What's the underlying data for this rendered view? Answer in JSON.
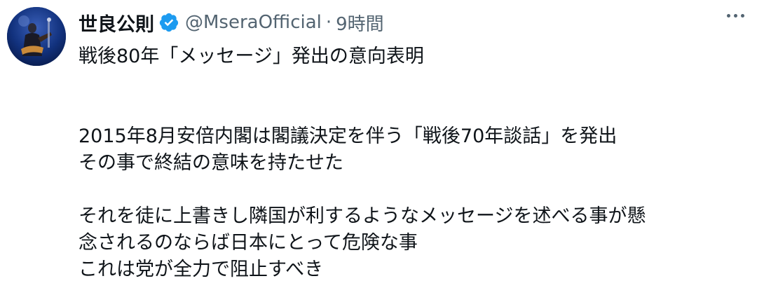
{
  "author": {
    "display_name": "世良公則",
    "handle": "@MseraOfficial",
    "separator": "·",
    "time": "9時間",
    "verified_icon": "verified-badge-icon",
    "avatar_icon": "profile-avatar"
  },
  "menu_icon": "more-options-icon",
  "tweet": {
    "line1": "戦後80年「メッセージ」発出の意向表明",
    "line2": "2015年8月安倍内閣は閣議決定を伴う「戦後70年談話」を発出",
    "line3": "その事で終結の意味を持たせた",
    "line4": "それを徒に上書きし隣国が利するようなメッセージを述べる事が懸",
    "line5": "念されるのならば日本にとって危険な事",
    "line6": "これは党が全力で阻止すべき"
  },
  "colors": {
    "text": "#0f1419",
    "secondary": "#536471",
    "verified": "#1d9bf0",
    "background": "#ffffff"
  }
}
